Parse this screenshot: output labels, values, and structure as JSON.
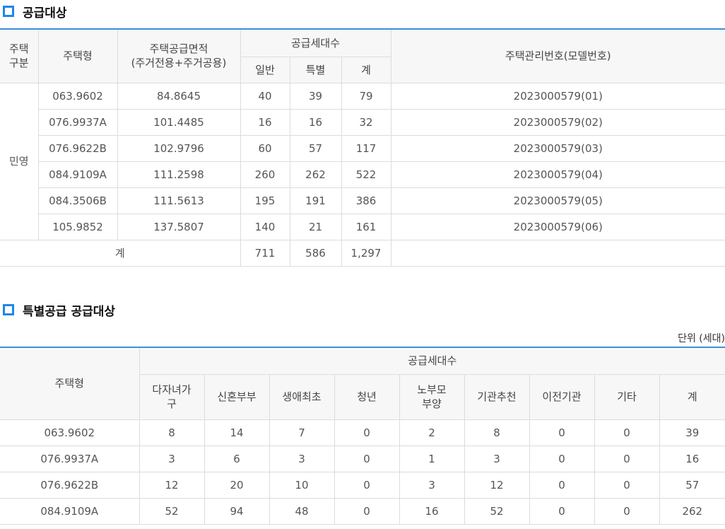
{
  "section1": {
    "title": "공급대상"
  },
  "table1": {
    "headers": {
      "house_category": "주택\n구분",
      "house_type": "주택형",
      "supply_area": "주택공급면적\n(주거전용+주거공용)",
      "supply_units": "공급세대수",
      "general": "일반",
      "special": "특별",
      "total": "계",
      "mgmt_no": "주택관리번호(모델번호)"
    },
    "category_value": "민영",
    "rows": [
      {
        "type": "063.9602",
        "area": "84.8645",
        "general": "40",
        "special": "39",
        "total": "79",
        "mgmt": "2023000579(01)"
      },
      {
        "type": "076.9937A",
        "area": "101.4485",
        "general": "16",
        "special": "16",
        "total": "32",
        "mgmt": "2023000579(02)"
      },
      {
        "type": "076.9622B",
        "area": "102.9796",
        "general": "60",
        "special": "57",
        "total": "117",
        "mgmt": "2023000579(03)"
      },
      {
        "type": "084.9109A",
        "area": "111.2598",
        "general": "260",
        "special": "262",
        "total": "522",
        "mgmt": "2023000579(04)"
      },
      {
        "type": "084.3506B",
        "area": "111.5613",
        "general": "195",
        "special": "191",
        "total": "386",
        "mgmt": "2023000579(05)"
      },
      {
        "type": "105.9852",
        "area": "137.5807",
        "general": "140",
        "special": "21",
        "total": "161",
        "mgmt": "2023000579(06)"
      }
    ],
    "sum": {
      "label": "계",
      "general": "711",
      "special": "586",
      "total": "1,297",
      "mgmt": ""
    }
  },
  "section2": {
    "title": "특별공급 공급대상",
    "unit": "단위 (세대)"
  },
  "table2": {
    "headers": {
      "house_type": "주택형",
      "supply_units": "공급세대수",
      "cols": [
        "다자녀가\n구",
        "신혼부부",
        "생애최초",
        "청년",
        "노부모\n부양",
        "기관추천",
        "이전기관",
        "기타",
        "계"
      ]
    },
    "rows": [
      {
        "type": "063.9602",
        "values": [
          "8",
          "14",
          "7",
          "0",
          "2",
          "8",
          "0",
          "0",
          "39"
        ]
      },
      {
        "type": "076.9937A",
        "values": [
          "3",
          "6",
          "3",
          "0",
          "1",
          "3",
          "0",
          "0",
          "16"
        ]
      },
      {
        "type": "076.9622B",
        "values": [
          "12",
          "20",
          "10",
          "0",
          "3",
          "12",
          "0",
          "0",
          "57"
        ]
      },
      {
        "type": "084.9109A",
        "values": [
          "52",
          "94",
          "48",
          "0",
          "16",
          "52",
          "0",
          "0",
          "262"
        ]
      }
    ]
  }
}
